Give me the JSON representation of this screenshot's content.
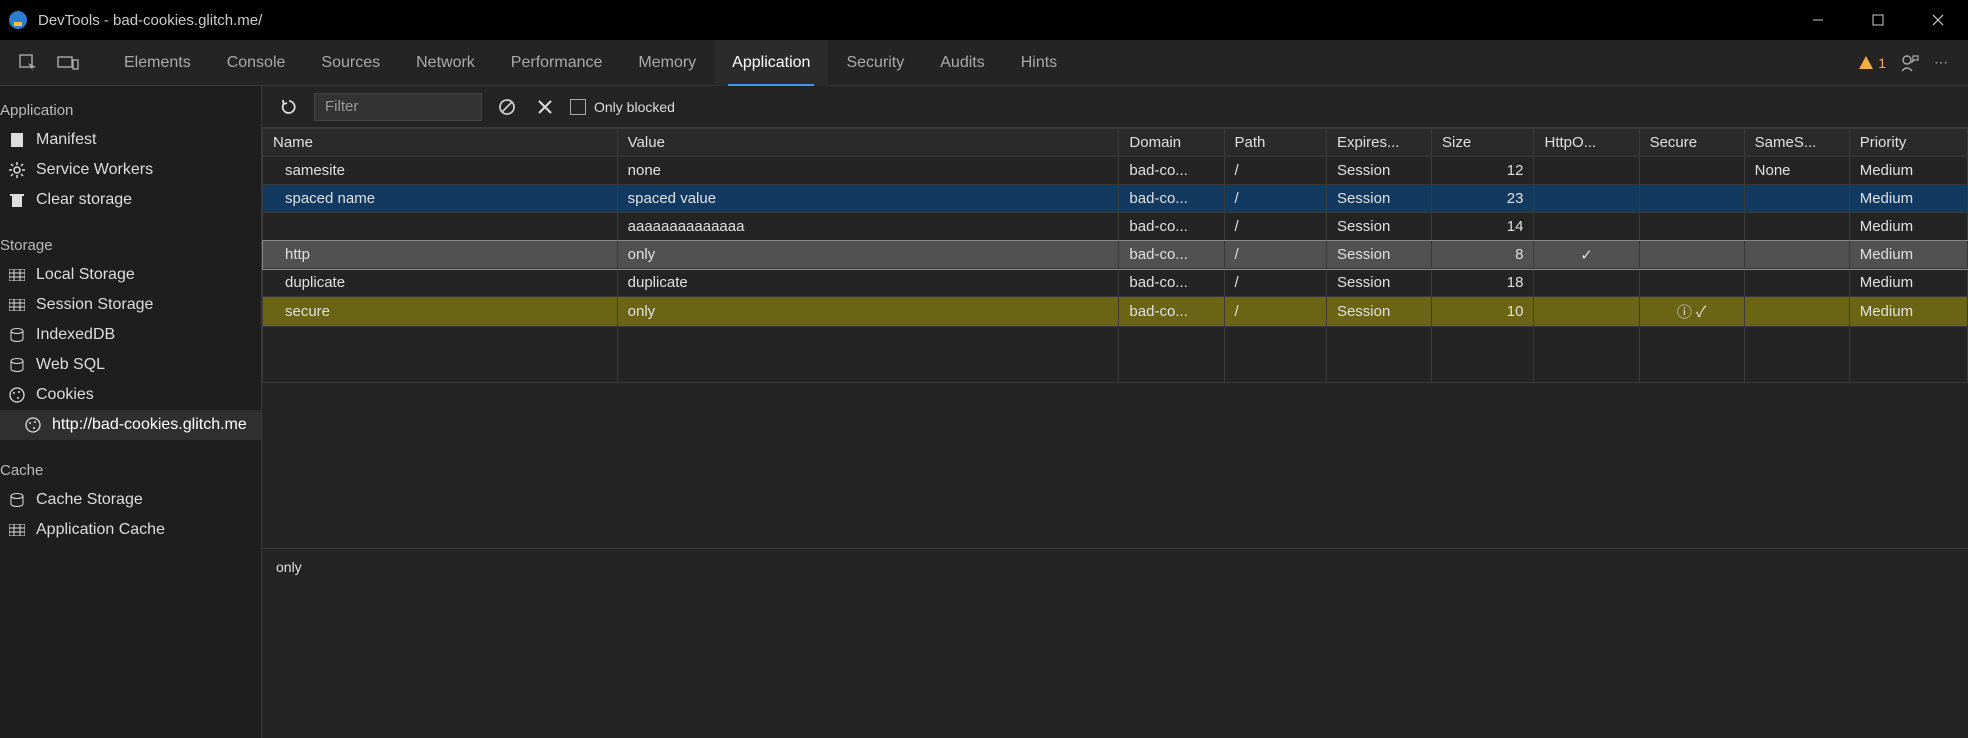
{
  "window": {
    "title": "DevTools - bad-cookies.glitch.me/"
  },
  "tabs": {
    "items": [
      "Elements",
      "Console",
      "Sources",
      "Network",
      "Performance",
      "Memory",
      "Application",
      "Security",
      "Audits",
      "Hints"
    ],
    "active": "Application",
    "warning_count": "1"
  },
  "sidebar": {
    "groups": [
      {
        "heading": "Application",
        "items": [
          {
            "icon": "file",
            "label": "Manifest"
          },
          {
            "icon": "gear",
            "label": "Service Workers"
          },
          {
            "icon": "trash",
            "label": "Clear storage"
          }
        ]
      },
      {
        "heading": "Storage",
        "items": [
          {
            "icon": "grid",
            "label": "Local Storage"
          },
          {
            "icon": "grid",
            "label": "Session Storage"
          },
          {
            "icon": "db",
            "label": "IndexedDB"
          },
          {
            "icon": "db",
            "label": "Web SQL"
          },
          {
            "icon": "cookie",
            "label": "Cookies",
            "expanded": true,
            "children": [
              {
                "icon": "cookie",
                "label": "http://bad-cookies.glitch.me",
                "selected": true
              }
            ]
          }
        ]
      },
      {
        "heading": "Cache",
        "items": [
          {
            "icon": "db",
            "label": "Cache Storage"
          },
          {
            "icon": "grid",
            "label": "Application Cache"
          }
        ]
      }
    ]
  },
  "toolbar": {
    "filter_placeholder": "Filter",
    "only_blocked_label": "Only blocked"
  },
  "table": {
    "columns": [
      "Name",
      "Value",
      "Domain",
      "Path",
      "Expires...",
      "Size",
      "HttpO...",
      "Secure",
      "SameS...",
      "Priority"
    ],
    "rows": [
      {
        "style": "normal",
        "name": "samesite",
        "value": "none",
        "domain": "bad-co...",
        "path": "/",
        "expires": "Session",
        "size": "12",
        "httponly": "",
        "secure": "",
        "samesite": "None",
        "priority": "Medium"
      },
      {
        "style": "blue",
        "name": "spaced name",
        "value": "spaced value",
        "domain": "bad-co...",
        "path": "/",
        "expires": "Session",
        "size": "23",
        "httponly": "",
        "secure": "",
        "samesite": "",
        "priority": "Medium"
      },
      {
        "style": "normal",
        "name": "",
        "value": "aaaaaaaaaaaaaa",
        "domain": "bad-co...",
        "path": "/",
        "expires": "Session",
        "size": "14",
        "httponly": "",
        "secure": "",
        "samesite": "",
        "priority": "Medium"
      },
      {
        "style": "gray-sel",
        "name": "http",
        "value": "only",
        "domain": "bad-co...",
        "path": "/",
        "expires": "Session",
        "size": "8",
        "httponly": "✓",
        "secure": "",
        "samesite": "",
        "priority": "Medium"
      },
      {
        "style": "normal",
        "name": "duplicate",
        "value": "duplicate",
        "domain": "bad-co...",
        "path": "/",
        "expires": "Session",
        "size": "18",
        "httponly": "",
        "secure": "",
        "samesite": "",
        "priority": "Medium"
      },
      {
        "style": "olive",
        "name": "secure",
        "value": "only",
        "domain": "bad-co...",
        "path": "/",
        "expires": "Session",
        "size": "10",
        "httponly": "",
        "secure": "ⓘ ✓",
        "samesite": "",
        "priority": "Medium"
      }
    ]
  },
  "detail": {
    "value": "only"
  }
}
